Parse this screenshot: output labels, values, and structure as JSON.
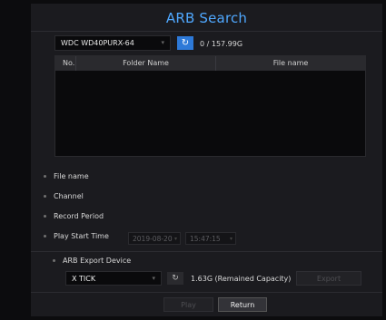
{
  "title": "ARB Search",
  "device": {
    "selected": "WDC WD40PURX-64",
    "capacity": "0 / 157.99G"
  },
  "table": {
    "headers": {
      "no": "No.",
      "folder": "Folder Name",
      "file": "File name"
    }
  },
  "fields": [
    {
      "label": "File name"
    },
    {
      "label": "Channel"
    },
    {
      "label": "Record Period"
    },
    {
      "label": "Play Start Time"
    }
  ],
  "play_start": {
    "date": "2019-08-20",
    "time": "15:47:15"
  },
  "export": {
    "heading": "ARB Export Device",
    "device": "X TICK",
    "remained": "1.63G (Remained Capacity)",
    "export_label": "Export"
  },
  "buttons": {
    "play": "Play",
    "return": "Return"
  },
  "colors": {
    "accent": "#4fa8ff",
    "button_blue": "#2d79d8",
    "panel": "#1b1b1f"
  },
  "icons": {
    "refresh": "refresh-icon",
    "caret": "chevron-down-icon"
  }
}
